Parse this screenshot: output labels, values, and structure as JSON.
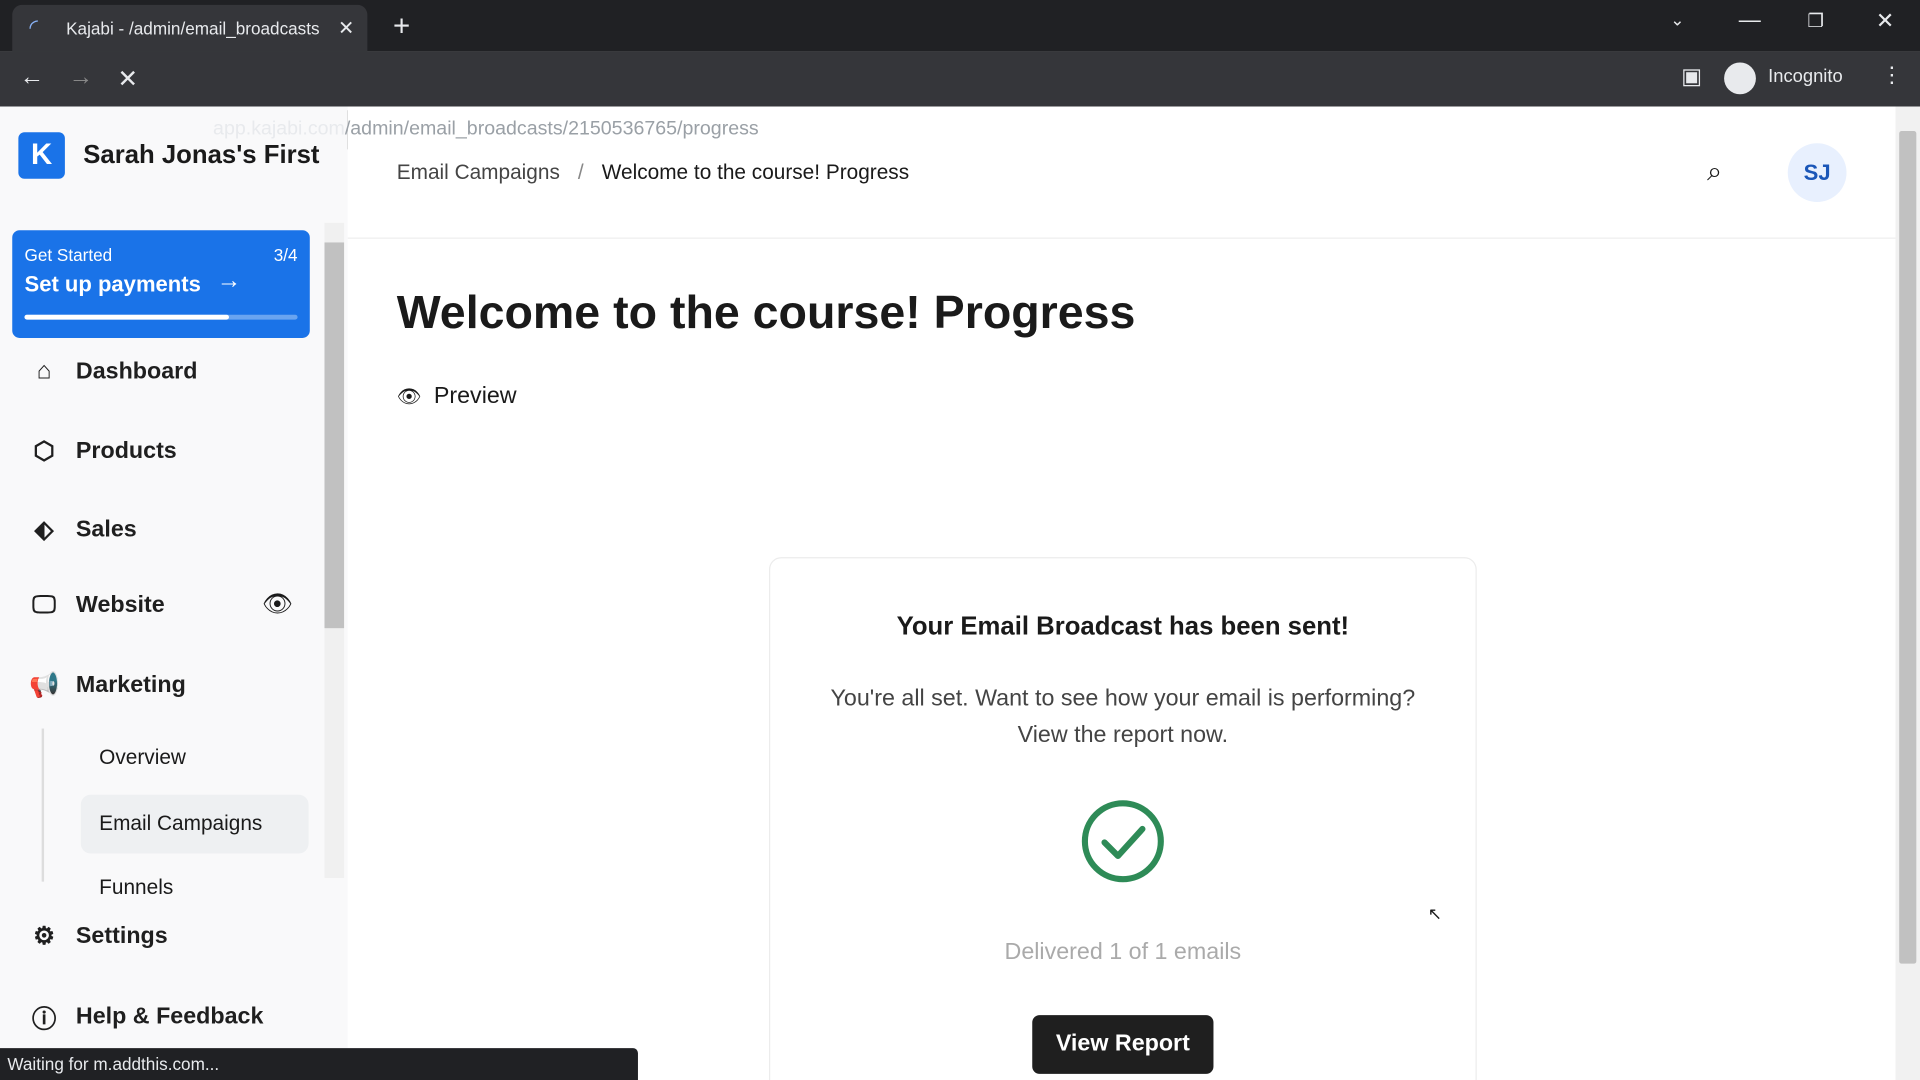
{
  "browser": {
    "tab_title": "Kajabi - /admin/email_broadcasts",
    "url_host": "app.kajabi.com",
    "url_path": "/admin/email_broadcasts/2150536765/progress",
    "profile": "Incognito",
    "status": "Waiting for m.addthis.com..."
  },
  "sidebar": {
    "site_name": "Sarah Jonas's First",
    "get_started": {
      "label": "Get Started",
      "count": "3/4",
      "action": "Set up payments",
      "progress": 0.75
    },
    "items": [
      {
        "label": "Dashboard"
      },
      {
        "label": "Products"
      },
      {
        "label": "Sales"
      },
      {
        "label": "Website"
      },
      {
        "label": "Marketing"
      }
    ],
    "subitems": [
      {
        "label": "Overview"
      },
      {
        "label": "Email Campaigns"
      },
      {
        "label": "Funnels"
      }
    ],
    "bottom": [
      {
        "label": "Settings"
      },
      {
        "label": "Help & Feedback"
      }
    ]
  },
  "header": {
    "breadcrumb": [
      "Email Campaigns",
      "Welcome to the course! Progress"
    ],
    "avatar": "SJ"
  },
  "main": {
    "title": "Welcome to the course! Progress",
    "preview": "Preview",
    "card": {
      "heading": "Your Email Broadcast has been sent!",
      "line1": "You're all set. Want to see how your email is performing?",
      "line2": "View the report now.",
      "delivered": "Delivered 1 of 1 emails",
      "button": "View Report"
    }
  },
  "colors": {
    "brand": "#1a73e8",
    "success": "#2e8b57"
  }
}
